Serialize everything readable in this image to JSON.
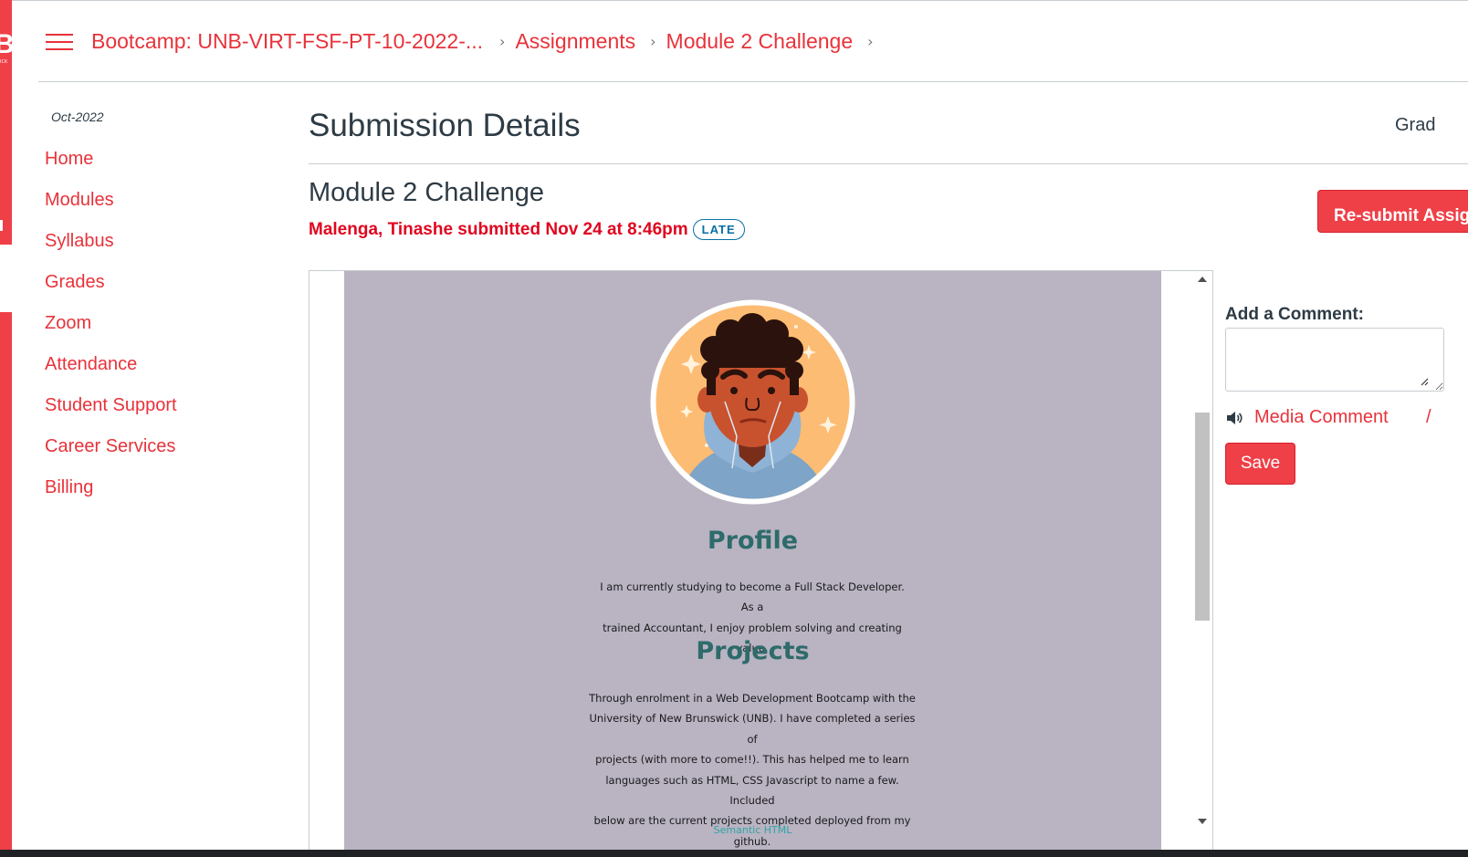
{
  "global_nav": {
    "logo_letter": "B",
    "logo_small": "ICK"
  },
  "header": {
    "breadcrumbs": [
      {
        "label": "Bootcamp: UNB-VIRT-FSF-PT-10-2022-..."
      },
      {
        "label": "Assignments"
      },
      {
        "label": "Module 2 Challenge"
      }
    ],
    "separator": "›"
  },
  "course_nav": {
    "term": "Oct-2022",
    "items": [
      {
        "label": "Home"
      },
      {
        "label": "Modules"
      },
      {
        "label": "Syllabus"
      },
      {
        "label": "Grades"
      },
      {
        "label": "Zoom"
      },
      {
        "label": "Attendance"
      },
      {
        "label": "Student Support"
      },
      {
        "label": "Career Services"
      },
      {
        "label": "Billing"
      }
    ]
  },
  "content": {
    "page_title": "Submission Details",
    "grade_label": "Grad",
    "assignment_title": "Module 2 Challenge",
    "submitted_text": "Malenga, Tinashe submitted Nov 24 at 8:46pm",
    "late_badge": "LATE",
    "resubmit_label": "Re-submit Assignment"
  },
  "preview": {
    "profile_heading": "Profile",
    "profile_lines": [
      "I am currently studying to become a Full Stack Developer. As a",
      "trained Accountant, I enjoy problem solving and creating value."
    ],
    "projects_heading": "Projects",
    "projects_lines": [
      "Through enrolment in a Web Development Bootcamp with the",
      "University of New Brunswick (UNB). I have completed a series of",
      "projects (with more to come!!). This has helped me to learn",
      "languages such as HTML, CSS Javascript to name a few. Included",
      "below are the current projects completed deployed from my",
      "github."
    ],
    "partial_link": "Semantic HTML"
  },
  "comments": {
    "label": "Add a Comment:",
    "textarea_value": "",
    "media_comment": "Media Comment",
    "save_label": "Save"
  },
  "colors": {
    "brand_red": "#ef3f47",
    "link_red": "#e8323a",
    "submitted_red": "#e0061f",
    "late_blue": "#0770a3",
    "portfolio_bg": "#b9b3c2",
    "portfolio_heading": "#2e6b6b"
  },
  "icons": {
    "menu": "hamburger-menu-icon",
    "avatar": "profile-avatar-illustration",
    "speaker": "speaker-icon",
    "scroll_up": "scroll-up-arrow-icon",
    "scroll_down": "scroll-down-arrow-icon"
  }
}
